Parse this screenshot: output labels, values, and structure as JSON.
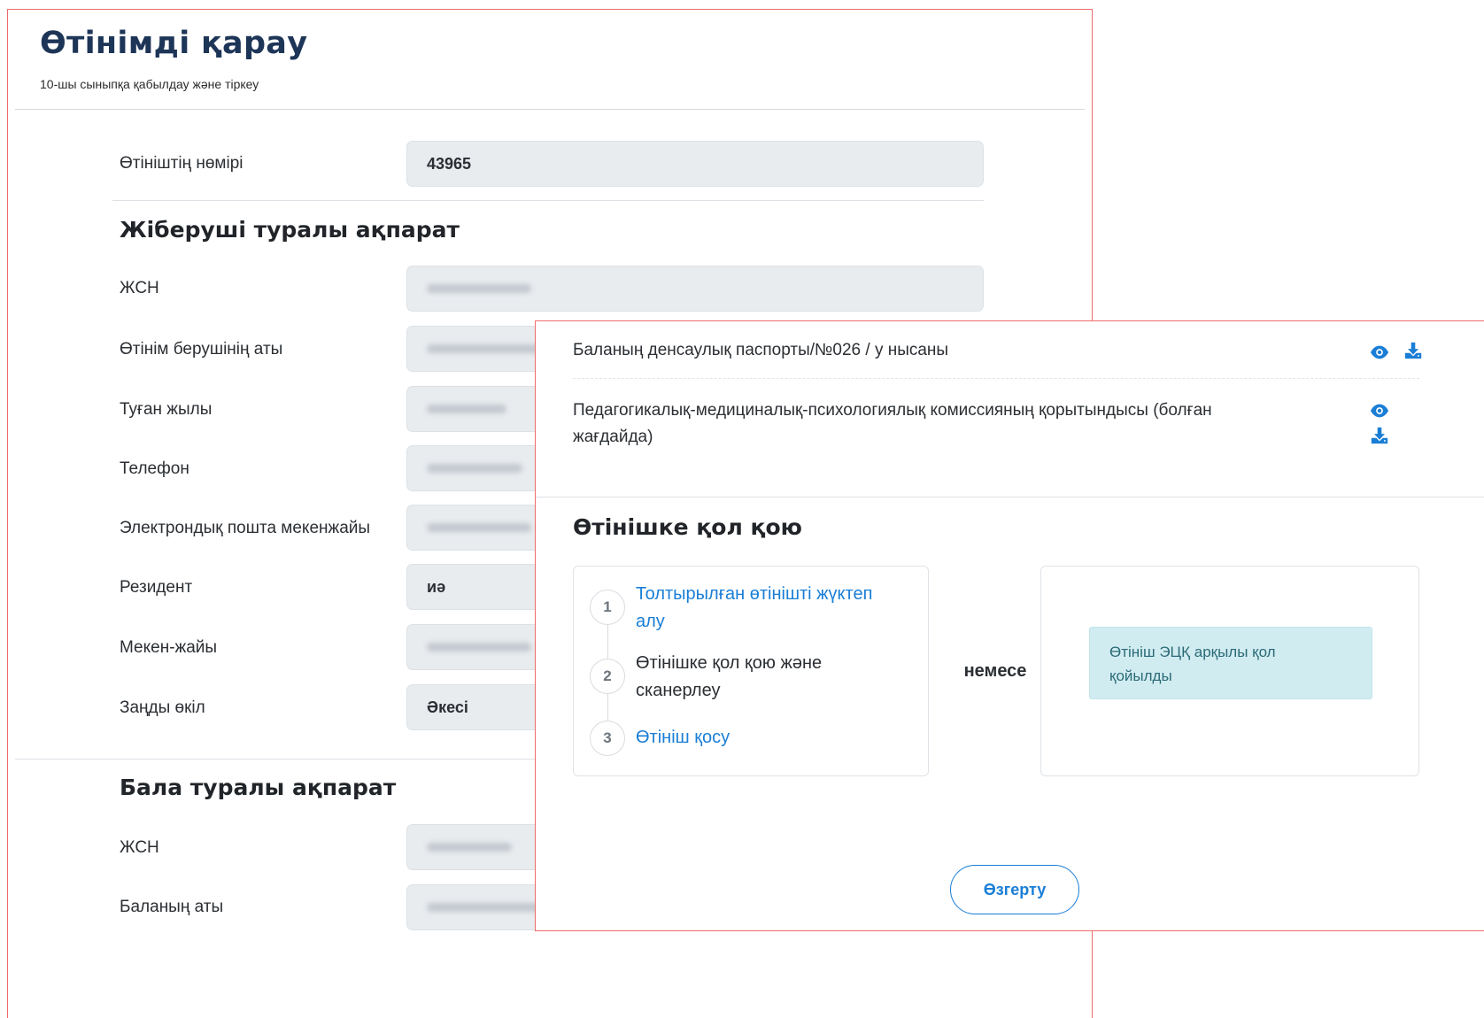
{
  "page": {
    "title": "Өтінімді қарау",
    "subtitle": "10-шы сыныпқа қабылдау және тіркеу"
  },
  "application": {
    "number_label": "Өтініштің нөмірі",
    "number_value": "43965"
  },
  "sender": {
    "title": "Жіберуші туралы ақпарат",
    "fields": [
      {
        "label": "ЖСН",
        "value": ""
      },
      {
        "label": "Өтінім берушінің аты",
        "value": ""
      },
      {
        "label": "Туған жылы",
        "value": ""
      },
      {
        "label": "Телефон",
        "value": ""
      },
      {
        "label": "Электрондық пошта мекенжайы",
        "value": ""
      },
      {
        "label": "Резидент",
        "value": "иә"
      },
      {
        "label": "Мекен-жайы",
        "value": ""
      },
      {
        "label": "Заңды өкіл",
        "value": "Әкесі"
      }
    ]
  },
  "child": {
    "title": "Бала туралы ақпарат",
    "fields": [
      {
        "label": "ЖСН",
        "value": ""
      },
      {
        "label": "Баланың аты",
        "value": ""
      }
    ]
  },
  "documents": [
    {
      "name": "Баланың денсаулық паспорты/№026 / у нысаны"
    },
    {
      "name_line1": "Педагогикалық-медициналық-психологиялық комиссияның қорытындысы (болған",
      "name_line2": "жағдайда)"
    }
  ],
  "signing": {
    "title": "Өтінішке қол қою",
    "steps": [
      {
        "num": "1",
        "line1": "Толтырылған өтінішті жүктеп",
        "line2": "алу"
      },
      {
        "num": "2",
        "line1": "Өтінішке қол қою және",
        "line2": "сканерлеу"
      },
      {
        "num": "3",
        "line1": "Өтініш қосу"
      }
    ],
    "or_label": "немесе",
    "ecp_line1": "Өтініш ЭЦҚ арқылы қол",
    "ecp_line2": "қойылды",
    "change_button": "Өзгерту"
  },
  "icons": {
    "view": "eye-icon",
    "download": "download-icon"
  },
  "colors": {
    "title": "#1d3557",
    "link": "#1a7ed6",
    "border_highlight": "#ef6b6b",
    "alert_bg": "#d1ecf1",
    "alert_text": "#2a6a77"
  }
}
